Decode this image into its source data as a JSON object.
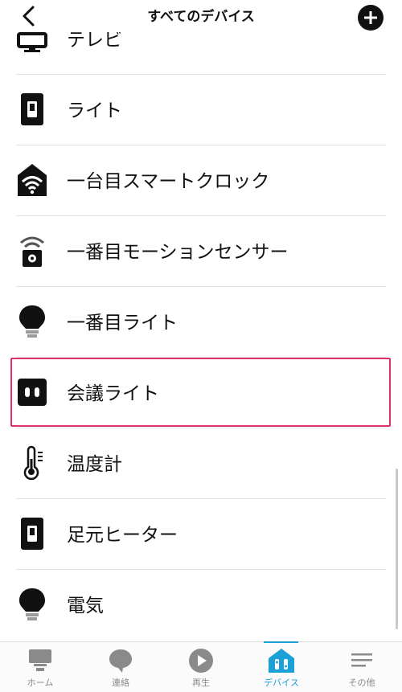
{
  "header": {
    "title": "すべてのデバイス",
    "back_icon": "chevron-left-icon",
    "add_icon": "plus-circle-icon"
  },
  "devices": [
    {
      "label": "テレビ",
      "icon": "tv-icon"
    },
    {
      "label": "ライト",
      "icon": "switch-icon"
    },
    {
      "label": "一台目スマートクロック",
      "icon": "smart-home-wifi-icon"
    },
    {
      "label": "一番目モーションセンサー",
      "icon": "motion-sensor-icon"
    },
    {
      "label": "一番目ライト",
      "icon": "bulb-icon"
    },
    {
      "label": "会議ライト",
      "icon": "plug-icon",
      "highlighted": true
    },
    {
      "label": "温度計",
      "icon": "thermometer-icon"
    },
    {
      "label": "足元ヒーター",
      "icon": "switch-icon"
    },
    {
      "label": "電気",
      "icon": "bulb-icon"
    }
  ],
  "tabs": [
    {
      "label": "ホーム",
      "icon": "home-icon"
    },
    {
      "label": "連絡",
      "icon": "chat-bubble-icon"
    },
    {
      "label": "再生",
      "icon": "play-icon"
    },
    {
      "label": "デバイス",
      "icon": "devices-icon",
      "active": true
    },
    {
      "label": "その他",
      "icon": "menu-icon"
    }
  ],
  "colors": {
    "accent": "#1ba1d8",
    "highlight_border": "#e2306c",
    "icon_dark": "#111111",
    "tab_inactive": "#8a8a8a"
  }
}
